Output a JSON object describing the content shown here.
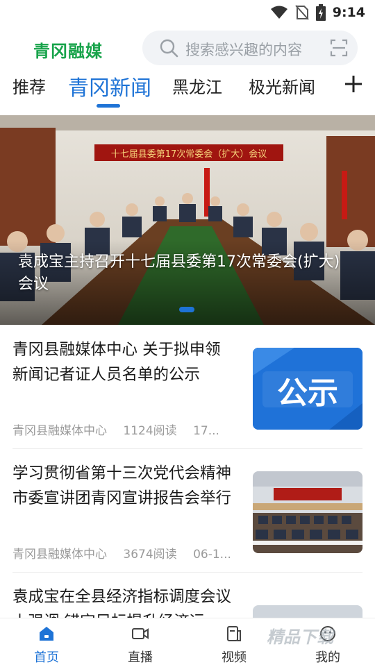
{
  "status_bar": {
    "time": "9:14"
  },
  "header": {
    "logo": "青冈融媒",
    "search_placeholder": "搜索感兴趣的内容"
  },
  "tabs": [
    {
      "label": "推荐",
      "active": false
    },
    {
      "label": "青冈新闻",
      "active": true
    },
    {
      "label": "黑龙江",
      "active": false
    },
    {
      "label": "极光新闻",
      "active": false
    }
  ],
  "banner": {
    "banner_text": "十七届县委第17次常委会（扩大）会议",
    "caption": "袁成宝主持召开十七届县委第17次常委会(扩大)会议"
  },
  "articles": [
    {
      "title": "青冈县融媒体中心 关于拟申领新闻记者证人员名单的公示",
      "source": "青冈县融媒体中心",
      "reads": "1124阅读",
      "date": "17...",
      "thumb_text": "公示"
    },
    {
      "title": "学习贯彻省第十三次党代会精神市委宣讲团青冈宣讲报告会举行",
      "source": "青冈县融媒体中心",
      "reads": "3674阅读",
      "date": "06-1..."
    },
    {
      "title": "袁成宝在全县经济指标调度会议上强调 锚定目标提升经济运"
    }
  ],
  "bottom_nav": [
    {
      "label": "首页",
      "icon": "home-icon",
      "active": true
    },
    {
      "label": "直播",
      "icon": "live-camera-icon",
      "active": false
    },
    {
      "label": "视频",
      "icon": "video-icon",
      "active": false
    },
    {
      "label": "我的",
      "icon": "profile-icon",
      "active": false
    }
  ],
  "watermark": "精品下载",
  "colors": {
    "accent": "#1e73d6",
    "brand_green": "#17a34a"
  }
}
